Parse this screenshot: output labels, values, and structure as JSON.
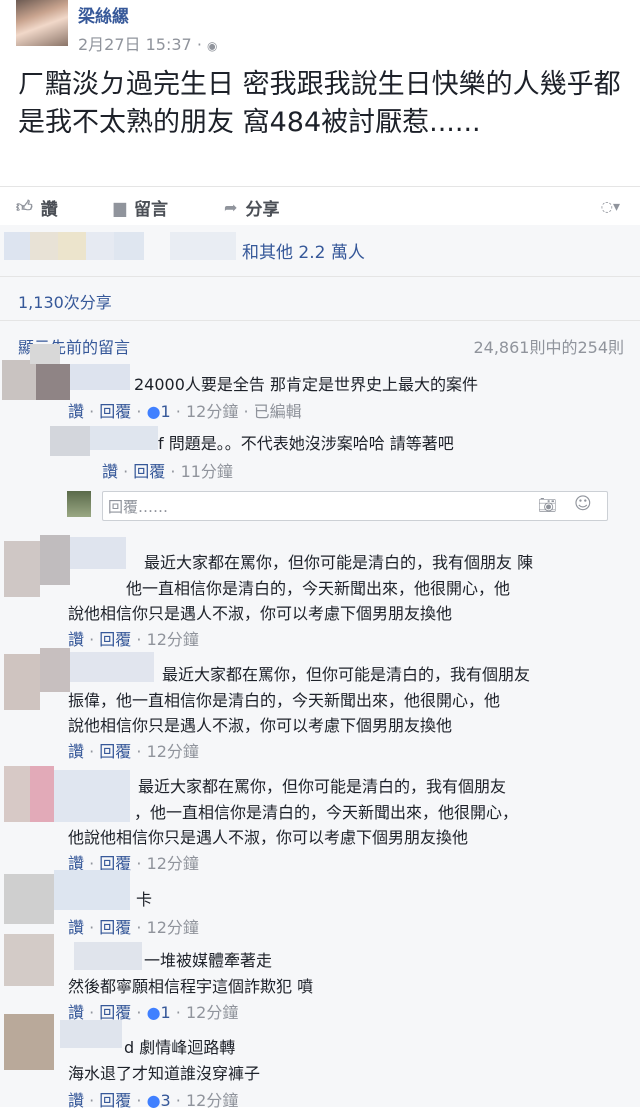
{
  "post": {
    "author": "梁絲縲",
    "timestamp": "2月27日 15:37 · ",
    "text": "ㄏ黯淡ㄉ過完生日 密我跟我說生日快樂的人幾乎都是我不太熟的朋友 窩484被討厭惹......"
  },
  "actions": {
    "like": "讚",
    "comment": "留言",
    "share": "分享"
  },
  "reactions": {
    "summary": "和其他 2.2 萬人"
  },
  "shares": {
    "count": "1,130次分享"
  },
  "comments_header": {
    "show_previous": "顯示先前的留言",
    "count": "24,861則中的254則"
  },
  "reply_placeholder": "回覆……",
  "comments": [
    {
      "text": "24000人要是全告 那肯定是世界史上最大的案件",
      "like": "讚",
      "reply": "回覆",
      "likes": "1",
      "time": "12分鐘",
      "edited": "已編輯"
    },
    {
      "text": "f 問題是。。不代表她沒涉案哈哈 請等著吧",
      "like": "讚",
      "reply": "回覆",
      "time": "11分鐘"
    },
    {
      "line1": "最近大家都在罵你，但你可能是清白的，我有個朋友 陳",
      "line2": "他一直相信你是清白的，今天新聞出來，他很開心，他",
      "line3": "說他相信你只是遇人不淑，你可以考慮下個男朋友換他",
      "like": "讚",
      "reply": "回覆",
      "time": "12分鐘"
    },
    {
      "line1": "最近大家都在罵你，但你可能是清白的，我有個朋友",
      "line2": "振偉，他一直相信你是清白的，今天新聞出來，他很開心，他",
      "line3": "說他相信你只是遇人不淑，你可以考慮下個男朋友換他",
      "like": "讚",
      "reply": "回覆",
      "time": "12分鐘"
    },
    {
      "line1": "最近大家都在罵你，但你可能是清白的，我有個朋友",
      "line2": "，他一直相信你是清白的，今天新聞出來，他很開心，",
      "line3": "他說他相信你只是遇人不淑，你可以考慮下個男朋友換他",
      "like": "讚",
      "reply": "回覆",
      "time": "12分鐘"
    },
    {
      "text": "卡",
      "like": "讚",
      "reply": "回覆",
      "time": "12分鐘"
    },
    {
      "line1": "一堆被媒體牽著走",
      "line2": "然後都寧願相信程宇這個詐欺犯 噴",
      "like": "讚",
      "reply": "回覆",
      "likes": "1",
      "time": "12分鐘"
    },
    {
      "line1": "d 劇情峰迴路轉",
      "line2": "海水退了才知道誰沒穿褲子",
      "like": "讚",
      "reply": "回覆",
      "likes": "3",
      "time": "12分鐘"
    }
  ]
}
